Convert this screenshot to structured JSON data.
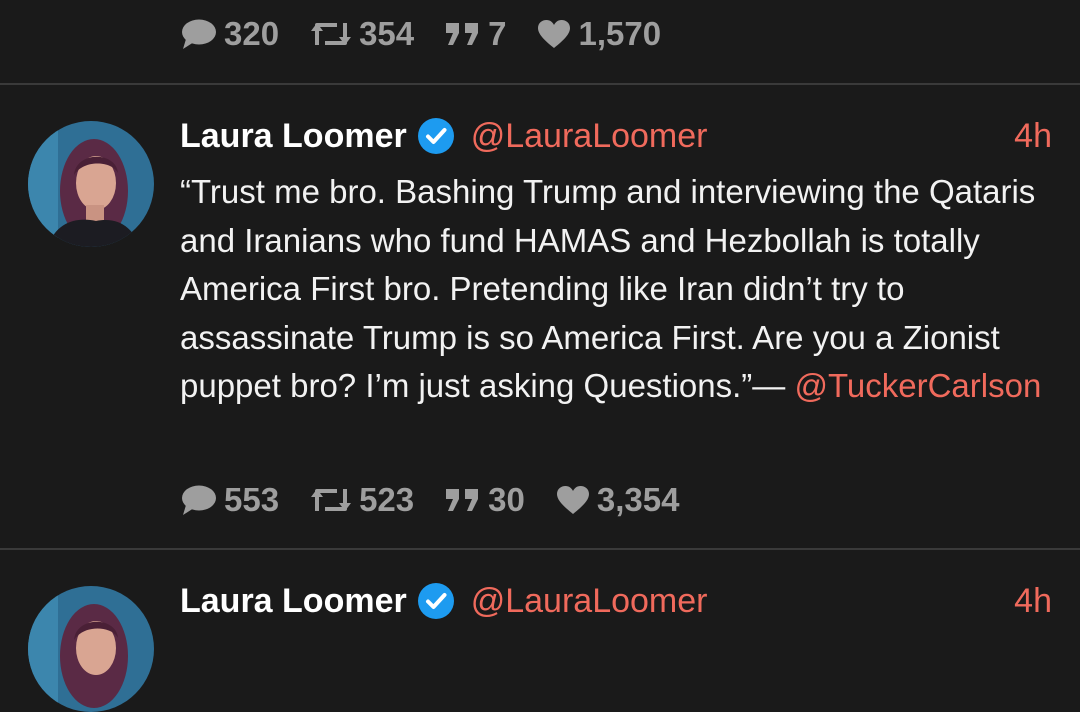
{
  "top_stats": {
    "replies": "320",
    "retweets": "354",
    "quotes": "7",
    "likes": "1,570"
  },
  "tweets": [
    {
      "name": "Laura Loomer",
      "handle": "@LauraLoomer",
      "time": "4h",
      "text": "“Trust me bro. Bashing Trump and interviewing the Qataris and Iranians who fund HAMAS and Hezbollah is totally America First bro. Pretending like Iran didn’t try to assassinate Trump is so America First. Are you a Zionist puppet bro? I’m just asking Questions.”—",
      "mention": "@TuckerCarlson",
      "stats": {
        "replies": "553",
        "retweets": "523",
        "quotes": "30",
        "likes": "3,354"
      }
    },
    {
      "name": "Laura Loomer",
      "handle": "@LauraLoomer",
      "time": "4h"
    }
  ],
  "icons": {
    "reply": "speech-bubble-icon",
    "retweet": "retweet-icon",
    "quote": "quote-icon",
    "like": "heart-icon",
    "verified": "verified-badge-icon"
  },
  "colors": {
    "background": "#1a1a1a",
    "accent": "#f06a5c",
    "verified": "#1d9bf0",
    "muted": "#9e9e9e"
  }
}
